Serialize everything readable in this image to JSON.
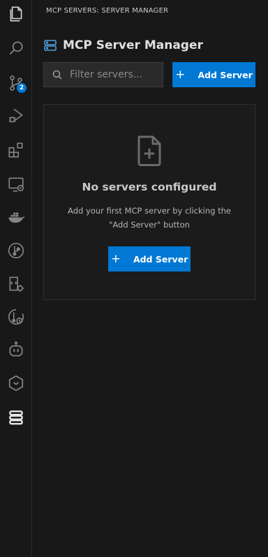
{
  "activity_bar": {
    "items": [
      {
        "name": "explorer",
        "icon": "files-icon"
      },
      {
        "name": "search",
        "icon": "search-icon"
      },
      {
        "name": "source-control",
        "icon": "source-control-icon",
        "badge": "2"
      },
      {
        "name": "run-debug",
        "icon": "run-debug-icon"
      },
      {
        "name": "extensions",
        "icon": "extensions-icon"
      },
      {
        "name": "remote-explorer",
        "icon": "remote-explorer-icon"
      },
      {
        "name": "docker",
        "icon": "docker-icon"
      },
      {
        "name": "git-graph",
        "icon": "git-graph-icon"
      },
      {
        "name": "container-settings",
        "icon": "container-settings-icon"
      },
      {
        "name": "git-history",
        "icon": "git-history-icon"
      },
      {
        "name": "copilot",
        "icon": "robot-icon"
      },
      {
        "name": "hexagon",
        "icon": "hexagon-icon"
      },
      {
        "name": "mcp-servers",
        "icon": "server-stack-icon",
        "active": true
      }
    ]
  },
  "panel": {
    "header": "MCP SERVERS: SERVER MANAGER",
    "title": "MCP Server Manager",
    "search_placeholder": "Filter servers...",
    "add_button_label": "Add Server",
    "add_button_plus": "+"
  },
  "empty_state": {
    "title": "No servers configured",
    "description": "Add your first MCP server by clicking the \"Add Server\" button",
    "button_label": "Add Server",
    "button_plus": "+"
  },
  "colors": {
    "accent": "#0078d4",
    "background": "#181818",
    "card_border": "#2f2f2f"
  }
}
